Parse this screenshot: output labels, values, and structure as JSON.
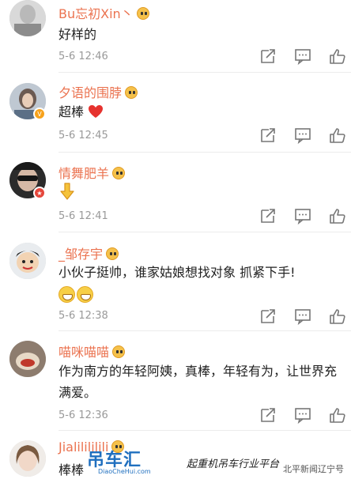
{
  "comments": [
    {
      "name": "Bu忘初Xin丶",
      "text": "好样的",
      "time": "5-6 12:46"
    },
    {
      "name": "夕语的围脖",
      "text": "超棒",
      "heart": "❤️",
      "time": "5-6 12:45"
    },
    {
      "name": "情舞肥羊",
      "text": "👇",
      "time": "5-6 12:41"
    },
    {
      "name": "_邹存宇",
      "text": "小伙子挺帅，谁家姑娘想找对象 抓紧下手!",
      "time": "5-6 12:38"
    },
    {
      "name": "喵咪喵喵",
      "text": "作为南方的年轻阿姨，真棒，年轻有为，让世界充满爱。",
      "time": "5-6 12:36"
    },
    {
      "name": "Jialilililili",
      "text": "棒棒",
      "time": ""
    }
  ],
  "watermark": {
    "logo": "吊车汇",
    "sub": "DiaoCheHui.com",
    "slogan": "起重机吊车行业平台",
    "news": "北平新闻辽宁号"
  },
  "icons": [
    "share-icon",
    "comment-icon",
    "like-icon"
  ],
  "colors": {
    "name": "#eb7350",
    "time": "#999999",
    "text": "#222222"
  }
}
